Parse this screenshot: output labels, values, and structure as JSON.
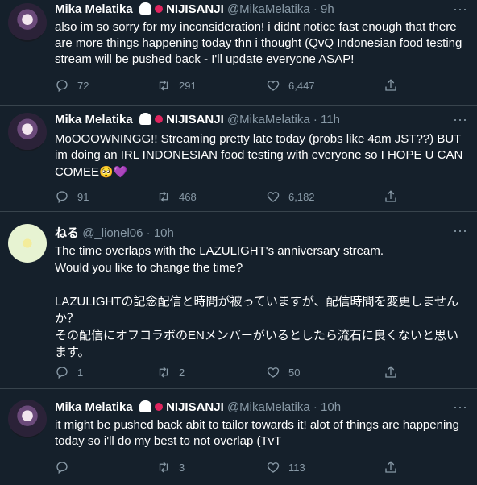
{
  "tweets": [
    {
      "name": "Mika Melatika",
      "badges": "👻📌",
      "tag": "NIJISANJI",
      "handle": "@MikaMelatika",
      "dot": "·",
      "time": "9h",
      "text": "also im so sorry for my inconsideration! i didnt notice fast enough that there are more things happening today thn i thought (QvQ Indonesian food testing stream will be pushed back - I'll update everyone ASAP!",
      "replies": "72",
      "retweets": "291",
      "likes": "6,447"
    },
    {
      "name": "Mika Melatika",
      "badges": "👻📌",
      "tag": "NIJISANJI",
      "handle": "@MikaMelatika",
      "dot": "·",
      "time": "11h",
      "text": "MoOOOWNINGG!! Streaming pretty late today (probs like 4am JST??) BUT im doing an IRL INDONESIAN food testing with everyone so I HOPE U CAN COMEE",
      "emoji": "🥺💜",
      "replies": "91",
      "retweets": "468",
      "likes": "6,182"
    },
    {
      "name": "ねる",
      "handle": "@_lionel06",
      "dot": "·",
      "time": "10h",
      "text": "The time overlaps with the LAZULIGHT's anniversary stream.\nWould you like to change the time?\n\nLAZULIGHTの記念配信と時間が被っていますが、配信時間を変更しませんか？\nその配信にオフコラボのENメンバーがいるとしたら流石に良くないと思います。",
      "replies": "1",
      "retweets": "2",
      "likes": "50"
    },
    {
      "name": "Mika Melatika",
      "badges": "👻📌",
      "tag": "NIJISANJI",
      "handle": "@MikaMelatika",
      "dot": "·",
      "time": "10h",
      "text": "it might be pushed back abit to tailor towards it! alot of things are happening today so i'll do my best to not overlap (TvT",
      "replies": "",
      "retweets": "3",
      "likes": "113"
    }
  ],
  "icons": [
    "reply-icon",
    "retweet-icon",
    "like-icon",
    "share-icon",
    "more-icon"
  ],
  "colors": {
    "background": "#15202b",
    "muted": "#8899a6",
    "border": "#38444d"
  }
}
